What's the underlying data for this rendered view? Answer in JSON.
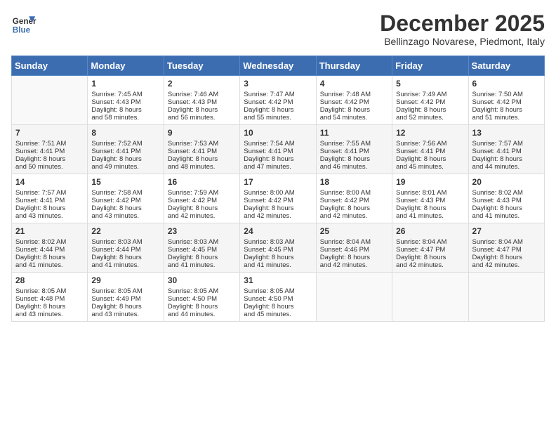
{
  "header": {
    "logo_line1": "General",
    "logo_line2": "Blue",
    "title": "December 2025",
    "subtitle": "Bellinzago Novarese, Piedmont, Italy"
  },
  "calendar": {
    "days_of_week": [
      "Sunday",
      "Monday",
      "Tuesday",
      "Wednesday",
      "Thursday",
      "Friday",
      "Saturday"
    ],
    "weeks": [
      [
        {
          "day": "",
          "content": ""
        },
        {
          "day": "1",
          "content": "Sunrise: 7:45 AM\nSunset: 4:43 PM\nDaylight: 8 hours\nand 58 minutes."
        },
        {
          "day": "2",
          "content": "Sunrise: 7:46 AM\nSunset: 4:43 PM\nDaylight: 8 hours\nand 56 minutes."
        },
        {
          "day": "3",
          "content": "Sunrise: 7:47 AM\nSunset: 4:42 PM\nDaylight: 8 hours\nand 55 minutes."
        },
        {
          "day": "4",
          "content": "Sunrise: 7:48 AM\nSunset: 4:42 PM\nDaylight: 8 hours\nand 54 minutes."
        },
        {
          "day": "5",
          "content": "Sunrise: 7:49 AM\nSunset: 4:42 PM\nDaylight: 8 hours\nand 52 minutes."
        },
        {
          "day": "6",
          "content": "Sunrise: 7:50 AM\nSunset: 4:42 PM\nDaylight: 8 hours\nand 51 minutes."
        }
      ],
      [
        {
          "day": "7",
          "content": "Sunrise: 7:51 AM\nSunset: 4:41 PM\nDaylight: 8 hours\nand 50 minutes."
        },
        {
          "day": "8",
          "content": "Sunrise: 7:52 AM\nSunset: 4:41 PM\nDaylight: 8 hours\nand 49 minutes."
        },
        {
          "day": "9",
          "content": "Sunrise: 7:53 AM\nSunset: 4:41 PM\nDaylight: 8 hours\nand 48 minutes."
        },
        {
          "day": "10",
          "content": "Sunrise: 7:54 AM\nSunset: 4:41 PM\nDaylight: 8 hours\nand 47 minutes."
        },
        {
          "day": "11",
          "content": "Sunrise: 7:55 AM\nSunset: 4:41 PM\nDaylight: 8 hours\nand 46 minutes."
        },
        {
          "day": "12",
          "content": "Sunrise: 7:56 AM\nSunset: 4:41 PM\nDaylight: 8 hours\nand 45 minutes."
        },
        {
          "day": "13",
          "content": "Sunrise: 7:57 AM\nSunset: 4:41 PM\nDaylight: 8 hours\nand 44 minutes."
        }
      ],
      [
        {
          "day": "14",
          "content": "Sunrise: 7:57 AM\nSunset: 4:41 PM\nDaylight: 8 hours\nand 43 minutes."
        },
        {
          "day": "15",
          "content": "Sunrise: 7:58 AM\nSunset: 4:42 PM\nDaylight: 8 hours\nand 43 minutes."
        },
        {
          "day": "16",
          "content": "Sunrise: 7:59 AM\nSunset: 4:42 PM\nDaylight: 8 hours\nand 42 minutes."
        },
        {
          "day": "17",
          "content": "Sunrise: 8:00 AM\nSunset: 4:42 PM\nDaylight: 8 hours\nand 42 minutes."
        },
        {
          "day": "18",
          "content": "Sunrise: 8:00 AM\nSunset: 4:42 PM\nDaylight: 8 hours\nand 42 minutes."
        },
        {
          "day": "19",
          "content": "Sunrise: 8:01 AM\nSunset: 4:43 PM\nDaylight: 8 hours\nand 41 minutes."
        },
        {
          "day": "20",
          "content": "Sunrise: 8:02 AM\nSunset: 4:43 PM\nDaylight: 8 hours\nand 41 minutes."
        }
      ],
      [
        {
          "day": "21",
          "content": "Sunrise: 8:02 AM\nSunset: 4:44 PM\nDaylight: 8 hours\nand 41 minutes."
        },
        {
          "day": "22",
          "content": "Sunrise: 8:03 AM\nSunset: 4:44 PM\nDaylight: 8 hours\nand 41 minutes."
        },
        {
          "day": "23",
          "content": "Sunrise: 8:03 AM\nSunset: 4:45 PM\nDaylight: 8 hours\nand 41 minutes."
        },
        {
          "day": "24",
          "content": "Sunrise: 8:03 AM\nSunset: 4:45 PM\nDaylight: 8 hours\nand 41 minutes."
        },
        {
          "day": "25",
          "content": "Sunrise: 8:04 AM\nSunset: 4:46 PM\nDaylight: 8 hours\nand 42 minutes."
        },
        {
          "day": "26",
          "content": "Sunrise: 8:04 AM\nSunset: 4:47 PM\nDaylight: 8 hours\nand 42 minutes."
        },
        {
          "day": "27",
          "content": "Sunrise: 8:04 AM\nSunset: 4:47 PM\nDaylight: 8 hours\nand 42 minutes."
        }
      ],
      [
        {
          "day": "28",
          "content": "Sunrise: 8:05 AM\nSunset: 4:48 PM\nDaylight: 8 hours\nand 43 minutes."
        },
        {
          "day": "29",
          "content": "Sunrise: 8:05 AM\nSunset: 4:49 PM\nDaylight: 8 hours\nand 43 minutes."
        },
        {
          "day": "30",
          "content": "Sunrise: 8:05 AM\nSunset: 4:50 PM\nDaylight: 8 hours\nand 44 minutes."
        },
        {
          "day": "31",
          "content": "Sunrise: 8:05 AM\nSunset: 4:50 PM\nDaylight: 8 hours\nand 45 minutes."
        },
        {
          "day": "",
          "content": ""
        },
        {
          "day": "",
          "content": ""
        },
        {
          "day": "",
          "content": ""
        }
      ]
    ]
  }
}
